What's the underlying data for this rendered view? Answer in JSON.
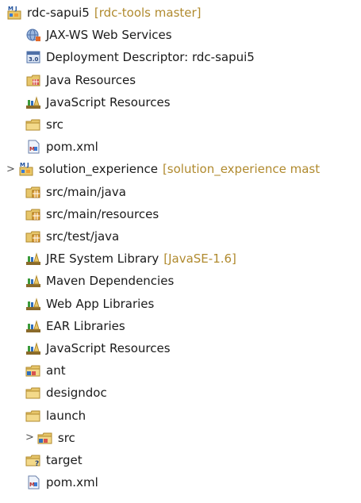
{
  "tree": {
    "rows": [
      {
        "label": "rdc-sapui5",
        "deco": "[rdc-tools master]",
        "icon": "maven-project-icon",
        "level": 0,
        "arrow": ""
      },
      {
        "label": "JAX-WS Web Services",
        "deco": "",
        "icon": "web-services-icon",
        "level": 1,
        "arrow": ""
      },
      {
        "label": "Deployment Descriptor: rdc-sapui5",
        "deco": "",
        "icon": "deployment-descriptor-icon",
        "level": 1,
        "arrow": ""
      },
      {
        "label": "Java Resources",
        "deco": "",
        "icon": "java-resources-icon",
        "level": 1,
        "arrow": ""
      },
      {
        "label": "JavaScript Resources",
        "deco": "",
        "icon": "library-icon",
        "level": 1,
        "arrow": ""
      },
      {
        "label": "src",
        "deco": "",
        "icon": "folder-icon",
        "level": 1,
        "arrow": ""
      },
      {
        "label": "pom.xml",
        "deco": "",
        "icon": "xml-file-icon",
        "level": 1,
        "arrow": ""
      },
      {
        "label": "solution_experience",
        "deco": "[solution_experience mast",
        "icon": "maven-project-icon",
        "level": 0,
        "arrow": ">"
      },
      {
        "label": "src/main/java",
        "deco": "",
        "icon": "source-folder-icon",
        "level": 1,
        "arrow": ""
      },
      {
        "label": "src/main/resources",
        "deco": "",
        "icon": "source-folder-icon",
        "level": 1,
        "arrow": ""
      },
      {
        "label": "src/test/java",
        "deco": "",
        "icon": "source-folder-icon",
        "level": 1,
        "arrow": ""
      },
      {
        "label": "JRE System Library",
        "deco": "[JavaSE-1.6]",
        "icon": "library-icon",
        "level": 1,
        "arrow": ""
      },
      {
        "label": "Maven Dependencies",
        "deco": "",
        "icon": "library-icon",
        "level": 1,
        "arrow": ""
      },
      {
        "label": "Web App Libraries",
        "deco": "",
        "icon": "library-icon",
        "level": 1,
        "arrow": ""
      },
      {
        "label": "EAR Libraries",
        "deco": "",
        "icon": "library-icon",
        "level": 1,
        "arrow": ""
      },
      {
        "label": "JavaScript Resources",
        "deco": "",
        "icon": "library-icon",
        "level": 1,
        "arrow": ""
      },
      {
        "label": "ant",
        "deco": "",
        "icon": "folder-changed-icon",
        "level": 1,
        "arrow": ""
      },
      {
        "label": "designdoc",
        "deco": "",
        "icon": "folder-icon",
        "level": 1,
        "arrow": ""
      },
      {
        "label": "launch",
        "deco": "",
        "icon": "folder-icon",
        "level": 1,
        "arrow": ""
      },
      {
        "label": "src",
        "deco": "",
        "icon": "folder-changed-icon",
        "level": 1,
        "arrow": ">"
      },
      {
        "label": "target",
        "deco": "",
        "icon": "folder-untracked-icon",
        "level": 1,
        "arrow": ""
      },
      {
        "label": "pom.xml",
        "deco": "",
        "icon": "xml-file-icon",
        "level": 1,
        "arrow": ""
      }
    ]
  },
  "colors": {
    "decoration": "#b08a2e",
    "folder": "#e7c66b",
    "library_book": "#3a9a3a"
  }
}
